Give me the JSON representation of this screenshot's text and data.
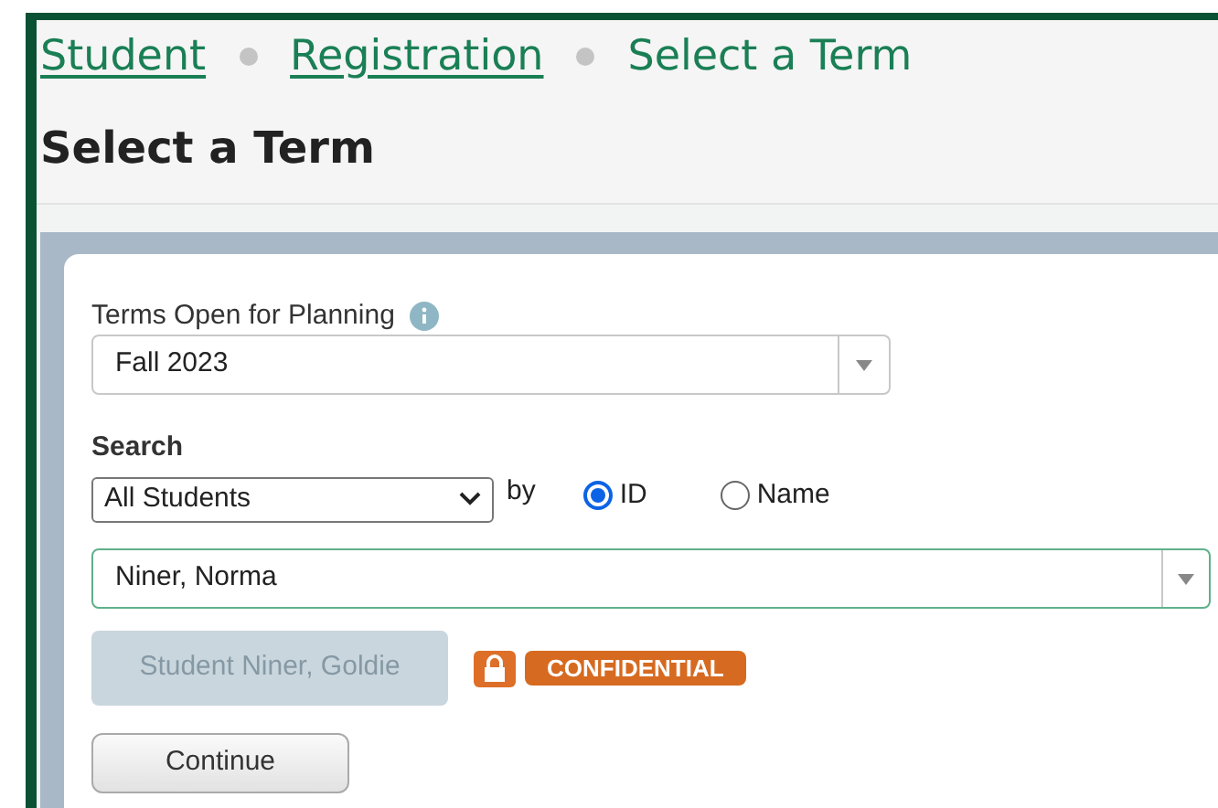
{
  "breadcrumb": [
    {
      "label": "Student",
      "kind": "link"
    },
    {
      "label": "Registration",
      "kind": "link"
    },
    {
      "label": "Select a Term",
      "kind": "current"
    }
  ],
  "page_title": "Select a Term",
  "term_field": {
    "label": "Terms Open for Planning",
    "value": "Fall 2023"
  },
  "search": {
    "heading": "Search",
    "scope": "All Students",
    "by_label": "by",
    "options": [
      {
        "label": "ID",
        "selected": true
      },
      {
        "label": "Name",
        "selected": false
      }
    ],
    "value": "Niner, Norma"
  },
  "student_button": {
    "label": "Student Niner, Goldie",
    "disabled": true
  },
  "badge": {
    "label": "CONFIDENTIAL"
  },
  "continue_button": {
    "label": "Continue"
  }
}
